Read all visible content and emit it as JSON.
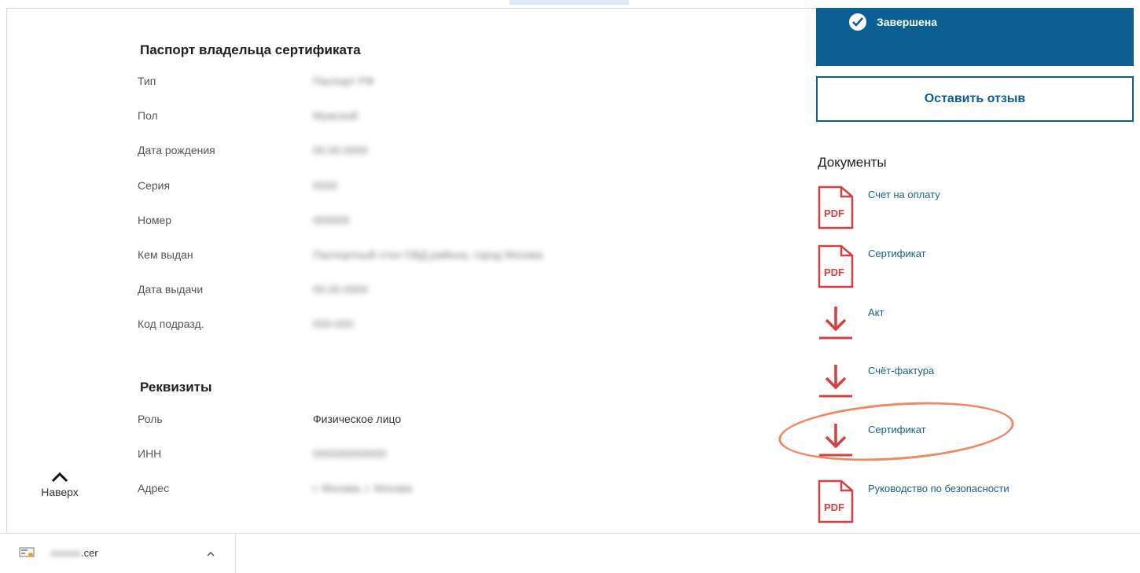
{
  "passport": {
    "title": "Паспорт владельца сертификата",
    "rows": [
      {
        "label": "Тип",
        "value": "Паспорт РФ"
      },
      {
        "label": "Пол",
        "value": "Мужской"
      },
      {
        "label": "Дата рождения",
        "value": "00.00.0000"
      },
      {
        "label": "Серия",
        "value": "0000"
      },
      {
        "label": "Номер",
        "value": "000000"
      },
      {
        "label": "Кем выдан",
        "value": "Паспортный стол ОВД района, город Москва"
      },
      {
        "label": "Дата выдачи",
        "value": "00.00.0000"
      },
      {
        "label": "Код подразд.",
        "value": "000-000"
      }
    ]
  },
  "requisites": {
    "title": "Реквизиты",
    "rows": [
      {
        "label": "Роль",
        "value": "Физическое лицо"
      },
      {
        "label": "ИНН",
        "value": "000000000000"
      },
      {
        "label": "Адрес",
        "value": "г. Москва, г. Москва"
      }
    ]
  },
  "status": {
    "text": "Завершена",
    "icon": "check-circle-icon",
    "color": "#0b5f93"
  },
  "feedback_button": {
    "label": "Оставить отзыв"
  },
  "documents": {
    "title": "Документы",
    "items": [
      {
        "label": "Счет на оплату",
        "icon": "pdf-icon"
      },
      {
        "label": "Сертификат",
        "icon": "pdf-icon"
      },
      {
        "label": "Акт",
        "icon": "download-icon"
      },
      {
        "label": "Счёт-фактура",
        "icon": "download-icon"
      },
      {
        "label": "Сертификат",
        "icon": "download-icon"
      },
      {
        "label": "Руководство по безопасности",
        "icon": "pdf-icon"
      }
    ]
  },
  "back_to_top": {
    "label": "Наверх",
    "icon": "chevron-up-icon"
  },
  "download_bar": {
    "file_name_hidden": "xxxxxx",
    "file_ext": ".cer",
    "icon": "certificate-file-icon"
  },
  "colors": {
    "brand": "#0b5f93",
    "doc_red": "#d64040",
    "link": "#1b5e8c",
    "highlight": "#ec8a64"
  }
}
